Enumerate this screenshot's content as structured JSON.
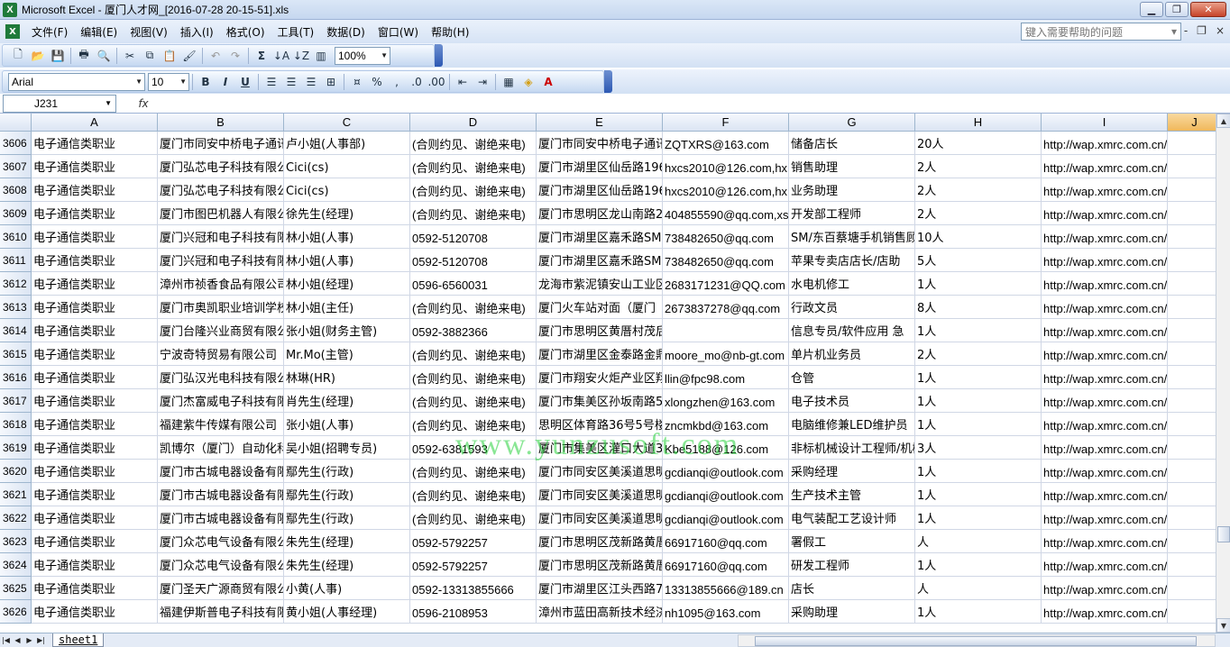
{
  "window": {
    "title": "Microsoft Excel - 厦门人才网_[2016-07-28 20-15-51].xls",
    "app_icon": "X",
    "minimize": "▁",
    "restore": "❐",
    "close": "✕"
  },
  "menu": {
    "items": [
      "文件(F)",
      "编辑(E)",
      "视图(V)",
      "插入(I)",
      "格式(O)",
      "工具(T)",
      "数据(D)",
      "窗口(W)",
      "帮助(H)"
    ],
    "help_placeholder": "键入需要帮助的问题",
    "right_controls": [
      "▾",
      "-",
      "❐",
      "×"
    ]
  },
  "toolbar1": {
    "zoom": "100%"
  },
  "toolbar2": {
    "font": "Arial",
    "size": "10",
    "bold": "B",
    "italic": "I",
    "underline": "U"
  },
  "formula_bar": {
    "name_box": "J231",
    "fx": "fx",
    "content": ""
  },
  "columns": [
    "A",
    "B",
    "C",
    "D",
    "E",
    "F",
    "G",
    "H",
    "I",
    "J"
  ],
  "selected_column": "J",
  "rows": [
    {
      "n": "3606",
      "A": "电子通信类职业",
      "B": "厦门市同安中桥电子通讯",
      "C": "卢小姐(人事部)",
      "D": "(合则约见、谢绝来电)",
      "E": "厦门市同安中桥电子通讯",
      "F": "ZQTXRS@163.com",
      "G": "储备店长",
      "H": "20人",
      "I": "http://wap.xmrc.com.cn/Wap/Info"
    },
    {
      "n": "3607",
      "A": "电子通信类职业",
      "B": "厦门弘芯电子科技有限公",
      "C": "Cici(cs)",
      "D": "(合则约见、谢绝来电)",
      "E": "厦门市湖里区仙岳路196",
      "F": "hxcs2010@126.com,hx",
      "G": "销售助理",
      "H": "2人",
      "I": "http://wap.xmrc.com.cn/Wap/Info"
    },
    {
      "n": "3608",
      "A": "电子通信类职业",
      "B": "厦门弘芯电子科技有限公",
      "C": "Cici(cs)",
      "D": "(合则约见、谢绝来电)",
      "E": "厦门市湖里区仙岳路196",
      "F": "hxcs2010@126.com,hx",
      "G": "业务助理",
      "H": "2人",
      "I": "http://wap.xmrc.com.cn/Wap/Info"
    },
    {
      "n": "3609",
      "A": "电子通信类职业",
      "B": "厦门市图巴机器人有限公",
      "C": "徐先生(经理)",
      "D": "(合则约见、谢绝来电)",
      "E": "厦门市思明区龙山南路2",
      "F": "404855590@qq.com,xs",
      "G": "开发部工程师",
      "H": "2人",
      "I": "http://wap.xmrc.com.cn/Wap/Info"
    },
    {
      "n": "3610",
      "A": "电子通信类职业",
      "B": "厦门兴冠和电子科技有限",
      "C": "林小姐(人事)",
      "D": "0592-5120708",
      "E": "厦门市湖里区嘉禾路SM",
      "F": "738482650@qq.com",
      "G": "SM/东百蔡塘手机销售顾",
      "H": "10人",
      "I": "http://wap.xmrc.com.cn/Wap/Info"
    },
    {
      "n": "3611",
      "A": "电子通信类职业",
      "B": "厦门兴冠和电子科技有限",
      "C": "林小姐(人事)",
      "D": "0592-5120708",
      "E": "厦门市湖里区嘉禾路SM",
      "F": "738482650@qq.com",
      "G": "苹果专卖店店长/店助",
      "H": "5人",
      "I": "http://wap.xmrc.com.cn/Wap/Info"
    },
    {
      "n": "3612",
      "A": "电子通信类职业",
      "B": "漳州市祯香食品有限公司",
      "C": "林小姐(经理)",
      "D": "0596-6560031",
      "E": "龙海市紫泥镇安山工业区",
      "F": "2683171231@QQ.com",
      "G": "水电机修工",
      "H": "1人",
      "I": "http://wap.xmrc.com.cn/Wap/Info"
    },
    {
      "n": "3613",
      "A": "电子通信类职业",
      "B": "厦门市奥凯职业培训学校",
      "C": "林小姐(主任)",
      "D": "(合则约见、谢绝来电)",
      "E": "厦门火车站对面（厦门",
      "F": "2673837278@qq.com",
      "G": "行政文员",
      "H": "8人",
      "I": "http://wap.xmrc.com.cn/Wap/Info"
    },
    {
      "n": "3614",
      "A": "电子通信类职业",
      "B": "厦门台隆兴业商贸有限公",
      "C": "张小姐(财务主管)",
      "D": "0592-3882366",
      "E": "厦门市思明区黄厝村茂后",
      "F": "",
      "G": "信息专员/软件应用  急",
      "H": "1人",
      "I": "http://wap.xmrc.com.cn/Wap/Info"
    },
    {
      "n": "3615",
      "A": "电子通信类职业",
      "B": "宁波奇特贸易有限公司",
      "C": "Mr.Mo(主管)",
      "D": "(合则约见、谢绝来电)",
      "E": "厦门市湖里区金泰路金鼎",
      "F": "moore_mo@nb-gt.com",
      "G": "单片机业务员",
      "H": "2人",
      "I": "http://wap.xmrc.com.cn/Wap/Info"
    },
    {
      "n": "3616",
      "A": "电子通信类职业",
      "B": "厦门弘汉光电科技有限公",
      "C": "林琳(HR)",
      "D": "(合则约见、谢绝来电)",
      "E": "厦门市翔安火炬产业区翔",
      "F": "llin@fpc98.com",
      "G": "仓管",
      "H": "1人",
      "I": "http://wap.xmrc.com.cn/Wap/Info"
    },
    {
      "n": "3617",
      "A": "电子通信类职业",
      "B": "厦门杰富威电子科技有限",
      "C": "肖先生(经理)",
      "D": "(合则约见、谢绝来电)",
      "E": "厦门市集美区孙坂南路5",
      "F": "xlongzhen@163.com",
      "G": "电子技术员",
      "H": "1人",
      "I": "http://wap.xmrc.com.cn/Wap/Info"
    },
    {
      "n": "3618",
      "A": "电子通信类职业",
      "B": "福建紫牛传媒有限公司",
      "C": "张小姐(人事)",
      "D": "(合则约见、谢绝来电)",
      "E": "思明区体育路36号5号楼",
      "F": "zncmkbd@163.com",
      "G": "电脑维修兼LED维护员",
      "H": "1人",
      "I": "http://wap.xmrc.com.cn/Wap/Info"
    },
    {
      "n": "3619",
      "A": "电子通信类职业",
      "B": "凯博尔（厦门）自动化科",
      "C": "吴小姐(招聘专员)",
      "D": "0592-6381593",
      "E": "厦门市集美区灌口大道3",
      "F": "Kbe5188@126.com",
      "G": "非标机械设计工程师/机械",
      "H": "3人",
      "I": "http://wap.xmrc.com.cn/Wap/Info"
    },
    {
      "n": "3620",
      "A": "电子通信类职业",
      "B": "厦门市古城电器设备有限",
      "C": "鄢先生(行政)",
      "D": "(合则约见、谢绝来电)",
      "E": "厦门市同安区美溪道思明",
      "F": "gcdianqi@outlook.com",
      "G": "采购经理",
      "H": "1人",
      "I": "http://wap.xmrc.com.cn/Wap/Info"
    },
    {
      "n": "3621",
      "A": "电子通信类职业",
      "B": "厦门市古城电器设备有限",
      "C": "鄢先生(行政)",
      "D": "(合则约见、谢绝来电)",
      "E": "厦门市同安区美溪道思明",
      "F": "gcdianqi@outlook.com",
      "G": "生产技术主管",
      "H": "1人",
      "I": "http://wap.xmrc.com.cn/Wap/Info"
    },
    {
      "n": "3622",
      "A": "电子通信类职业",
      "B": "厦门市古城电器设备有限",
      "C": "鄢先生(行政)",
      "D": "(合则约见、谢绝来电)",
      "E": "厦门市同安区美溪道思明",
      "F": "gcdianqi@outlook.com",
      "G": "电气装配工艺设计师",
      "H": "1人",
      "I": "http://wap.xmrc.com.cn/Wap/Info"
    },
    {
      "n": "3623",
      "A": "电子通信类职业",
      "B": "厦门众芯电气设备有限公",
      "C": "朱先生(经理)",
      "D": "0592-5792257",
      "E": "厦门市思明区茂新路黄厝",
      "F": "66917160@qq.com",
      "G": "署假工",
      "H": "人",
      "I": "http://wap.xmrc.com.cn/Wap/Info"
    },
    {
      "n": "3624",
      "A": "电子通信类职业",
      "B": "厦门众芯电气设备有限公",
      "C": "朱先生(经理)",
      "D": "0592-5792257",
      "E": "厦门市思明区茂新路黄厝",
      "F": "66917160@qq.com",
      "G": "研发工程师",
      "H": "1人",
      "I": "http://wap.xmrc.com.cn/Wap/Info"
    },
    {
      "n": "3625",
      "A": "电子通信类职业",
      "B": "厦门圣天广源商贸有限公",
      "C": "小黄(人事)",
      "D": "0592-13313855666",
      "E": "厦门市湖里区江头西路7",
      "F": "13313855666@189.cn",
      "G": "店长",
      "H": "人",
      "I": "http://wap.xmrc.com.cn/Wap/Info"
    },
    {
      "n": "3626",
      "A": "电子通信类职业",
      "B": "福建伊斯普电子科技有限",
      "C": "黄小姐(人事经理)",
      "D": "0596-2108953",
      "E": "漳州市蓝田高新技术经济",
      "F": "nh1095@163.com",
      "G": "采购助理",
      "H": "1人",
      "I": "http://wap.xmrc.com.cn/Wap/Info"
    }
  ],
  "watermark": "www.yunzusoft.com",
  "sheet_tabs": [
    "sheet1"
  ]
}
